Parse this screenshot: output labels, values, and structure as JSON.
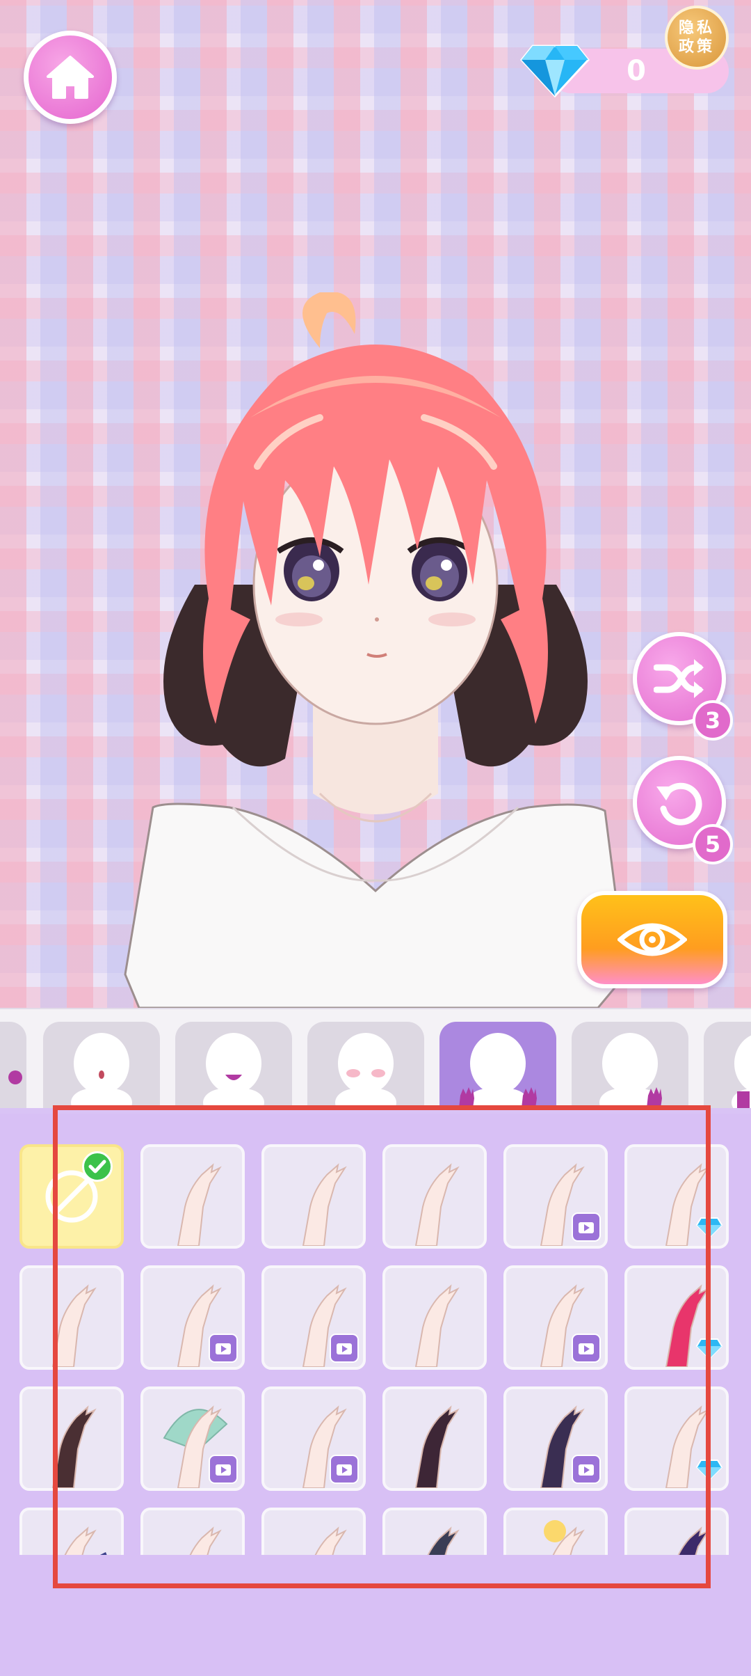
{
  "top_bar": {
    "home_icon": "house-icon",
    "gem_icon": "diamond-icon",
    "gem_count": "0",
    "privacy_label": "隐私政策"
  },
  "controls": {
    "shuffle_icon": "shuffle-icon",
    "shuffle_count": "3",
    "undo_icon": "undo-icon",
    "undo_count": "5",
    "preview_icon": "eye-icon"
  },
  "categories": [
    {
      "name": "partial-left",
      "icon": "head-silhouette-icon",
      "active": false
    },
    {
      "name": "mouth-small",
      "icon": "head-silhouette-icon",
      "active": false
    },
    {
      "name": "mouth-smile",
      "icon": "head-silhouette-icon",
      "active": false
    },
    {
      "name": "blush",
      "icon": "head-silhouette-icon",
      "active": false
    },
    {
      "name": "hands",
      "icon": "head-silhouette-icon",
      "active": true
    },
    {
      "name": "hand-accessory",
      "icon": "head-silhouette-icon",
      "active": false
    },
    {
      "name": "partial-right",
      "icon": "head-silhouette-icon",
      "active": false
    }
  ],
  "items": [
    {
      "badge": "none",
      "selected": true,
      "icon": "no-item-icon"
    },
    {
      "badge": "none",
      "icon": "hand-pose-icon"
    },
    {
      "badge": "none",
      "icon": "hand-pose-icon"
    },
    {
      "badge": "none",
      "icon": "peace-sign-hand-icon"
    },
    {
      "badge": "ad",
      "icon": "hand-pose-icon"
    },
    {
      "badge": "gem",
      "icon": "hand-pose-icon"
    },
    {
      "badge": "none",
      "icon": "fist-hand-icon"
    },
    {
      "badge": "ad",
      "icon": "hand-pose-icon"
    },
    {
      "badge": "ad",
      "icon": "hand-pose-icon"
    },
    {
      "badge": "none",
      "icon": "hand-pose-icon"
    },
    {
      "badge": "ad",
      "icon": "hand-pose-icon"
    },
    {
      "badge": "gem",
      "icon": "red-glove-hand-icon"
    },
    {
      "badge": "none",
      "icon": "glove-hand-icon"
    },
    {
      "badge": "ad",
      "icon": "fan-hand-icon"
    },
    {
      "badge": "ad",
      "icon": "hand-pose-icon"
    },
    {
      "badge": "none",
      "icon": "black-sleeve-hand-icon"
    },
    {
      "badge": "ad",
      "icon": "dark-glove-hand-icon"
    },
    {
      "badge": "gem",
      "icon": "open-hand-icon"
    },
    {
      "badge": "none",
      "icon": "wand-hand-icon"
    },
    {
      "badge": "none",
      "icon": "hand-pose-icon"
    },
    {
      "badge": "none",
      "icon": "peace-sign-hand-icon"
    },
    {
      "badge": "none",
      "icon": "gloved-hand-icon"
    },
    {
      "badge": "none",
      "icon": "sparkler-hand-icon"
    },
    {
      "badge": "none",
      "icon": "pointing-hand-icon"
    }
  ],
  "colors": {
    "accent_pink": "#e46ccf",
    "active_tab": "#ab88e0",
    "panel_bg": "#d8c0f5",
    "highlight_red": "#e5483f"
  }
}
